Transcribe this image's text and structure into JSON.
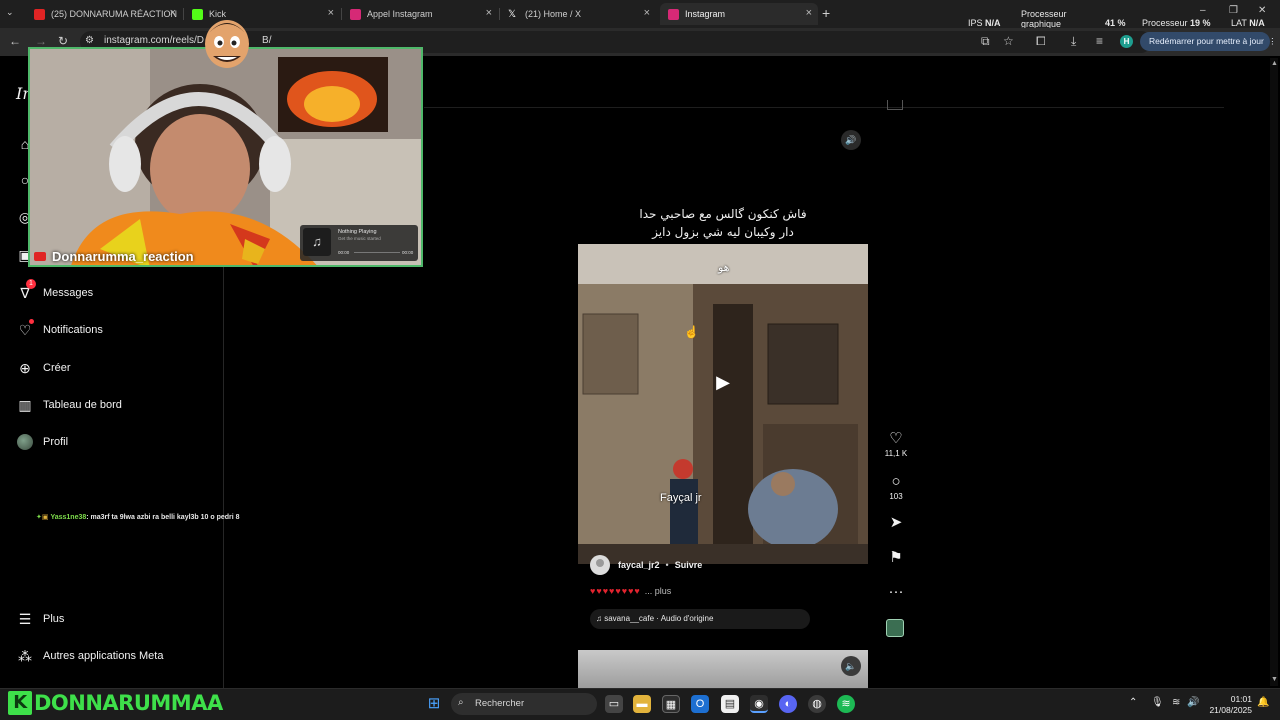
{
  "browser": {
    "tabs": [
      {
        "label": "(25) DONNARUMA RÉACTION",
        "favicon_color": "#e02424"
      },
      {
        "label": "Kick",
        "favicon_color": "#53fc18"
      },
      {
        "label": "Appel Instagram",
        "favicon_color": "#d62976"
      },
      {
        "label": "(21) Home / X",
        "favicon_color": "#ffffff"
      },
      {
        "label": "Instagram",
        "favicon_color": "#d62976"
      }
    ],
    "new_tab": "+",
    "url": "instagram.com/reels/D",
    "url_tail": "B/",
    "update_button": "Redémarrer pour mettre à jour",
    "profile_initial": "H"
  },
  "perf_overlay": {
    "ips_label": "IPS",
    "ips_value": "N/A",
    "gpu_label_1": "Processeur",
    "gpu_label_2": "graphique",
    "gpu_value": "41 %",
    "cpu_label": "Processeur",
    "cpu_value": "19 %",
    "lat_label": "LAT",
    "lat_value": "N/A"
  },
  "sidebar": {
    "logo": "In",
    "items": [
      {
        "label": "Messages",
        "icon": "messenger-icon",
        "badge": "1"
      },
      {
        "label": "Notifications",
        "icon": "heart-icon"
      },
      {
        "label": "Créer",
        "icon": "plus-square-icon"
      },
      {
        "label": "Tableau de bord",
        "icon": "chart-icon"
      },
      {
        "label": "Profil",
        "icon": "avatar"
      }
    ],
    "bottom_items": [
      {
        "label": "Plus",
        "icon": "menu-icon"
      },
      {
        "label": "Autres applications Meta",
        "icon": "meta-apps-icon"
      }
    ]
  },
  "chat": {
    "user": "Yass1ne38",
    "message": ": ma3rf ta 9lwa azbi ra belli kayl3b 10 o pedri 8"
  },
  "webcam": {
    "streamer": "Donnarumma_reaction",
    "now_playing_title": "Nothing Playing",
    "now_playing_sub": "Get the music started",
    "time_start": "00:00",
    "time_end": "00:00"
  },
  "reel": {
    "caption_line1": "فاش كنكون گالس مع صاحبي حدا",
    "caption_line2": "دار وكيبان ليه شي بزول دايز",
    "overlay_word": "هو",
    "overlay_name": "Fayçal jr",
    "author": "faycal_jr2",
    "follow": "Suivre",
    "hearts": "♥♥♥♥♥♥♥♥",
    "more": "... plus",
    "audio": "savana__cafe · Audio d'origine",
    "likes": "11,1 K",
    "comments": "103"
  },
  "taskbar": {
    "brand": "DONNARUMMAA",
    "search_placeholder": "Rechercher",
    "time": "01:01",
    "date": "21/08/2025"
  }
}
